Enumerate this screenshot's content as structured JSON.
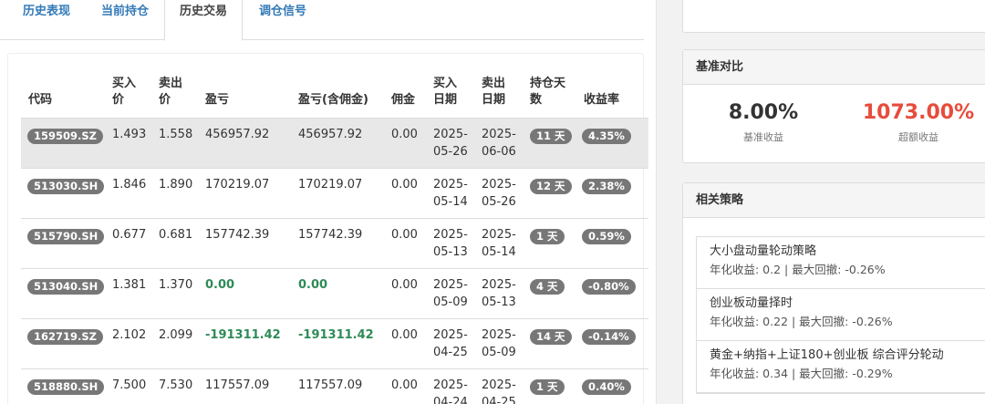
{
  "tabs": [
    "历史表现",
    "当前持仓",
    "历史交易",
    "调仓信号"
  ],
  "table": {
    "headers": {
      "code": "代码",
      "buy_price": [
        "买入",
        "价"
      ],
      "sell_price": [
        "卖出",
        "价"
      ],
      "pnl": "盈亏",
      "pnl_fee": "盈亏(含佣金)",
      "fee": "佣金",
      "buy_date": [
        "买入",
        "日期"
      ],
      "sell_date": [
        "卖出",
        "日期"
      ],
      "hold_days": [
        "持仓天",
        "数"
      ],
      "return": "收益率"
    },
    "rows": [
      {
        "code": "159509.SZ",
        "buy": "1.493",
        "sell": "1.558",
        "pnl": "456957.92",
        "pnl_fee": "456957.92",
        "fee": "0.00",
        "buy_date": [
          "2025-",
          "05-26"
        ],
        "sell_date": [
          "2025-",
          "06-06"
        ],
        "days": "11 天",
        "rate": "4.35%"
      },
      {
        "code": "513030.SH",
        "buy": "1.846",
        "sell": "1.890",
        "pnl": "170219.07",
        "pnl_fee": "170219.07",
        "fee": "0.00",
        "buy_date": [
          "2025-",
          "05-14"
        ],
        "sell_date": [
          "2025-",
          "05-26"
        ],
        "days": "12 天",
        "rate": "2.38%"
      },
      {
        "code": "515790.SH",
        "buy": "0.677",
        "sell": "0.681",
        "pnl": "157742.39",
        "pnl_fee": "157742.39",
        "fee": "0.00",
        "buy_date": [
          "2025-",
          "05-13"
        ],
        "sell_date": [
          "2025-",
          "05-14"
        ],
        "days": "1 天",
        "rate": "0.59%"
      },
      {
        "code": "513040.SH",
        "buy": "1.381",
        "sell": "1.370",
        "pnl": "0.00",
        "pnl_fee": "0.00",
        "fee": "0.00",
        "buy_date": [
          "2025-",
          "05-09"
        ],
        "sell_date": [
          "2025-",
          "05-13"
        ],
        "days": "4 天",
        "rate": "-0.80%"
      },
      {
        "code": "162719.SZ",
        "buy": "2.102",
        "sell": "2.099",
        "pnl": "-191311.42",
        "pnl_fee": "-191311.42",
        "fee": "0.00",
        "buy_date": [
          "2025-",
          "04-25"
        ],
        "sell_date": [
          "2025-",
          "05-09"
        ],
        "days": "14 天",
        "rate": "-0.14%"
      },
      {
        "code": "518880.SH",
        "buy": "7.500",
        "sell": "7.530",
        "pnl": "117557.09",
        "pnl_fee": "117557.09",
        "fee": "0.00",
        "buy_date": [
          "2025-",
          "04-24"
        ],
        "sell_date": [
          "2025-",
          "04-25"
        ],
        "days": "1 天",
        "rate": "0.40%"
      }
    ]
  },
  "benchmark": {
    "title": "基准对比",
    "base_value": "8.00%",
    "base_label": "基准收益",
    "excess_value": "1073.00%",
    "excess_label": "超额收益",
    "excess_color": "#e74c3c"
  },
  "strategies": {
    "title": "相关策略",
    "items": [
      {
        "name": "大小盘动量轮动策略",
        "meta": "年化收益: 0.2 | 最大回撤: -0.26%"
      },
      {
        "name": "创业板动量择时",
        "meta": "年化收益: 0.22 | 最大回撤: -0.26%"
      },
      {
        "name": "黄金+纳指+上证180+创业板 综合评分轮动",
        "meta": "年化收益: 0.34 | 最大回撤: -0.29%"
      }
    ]
  }
}
